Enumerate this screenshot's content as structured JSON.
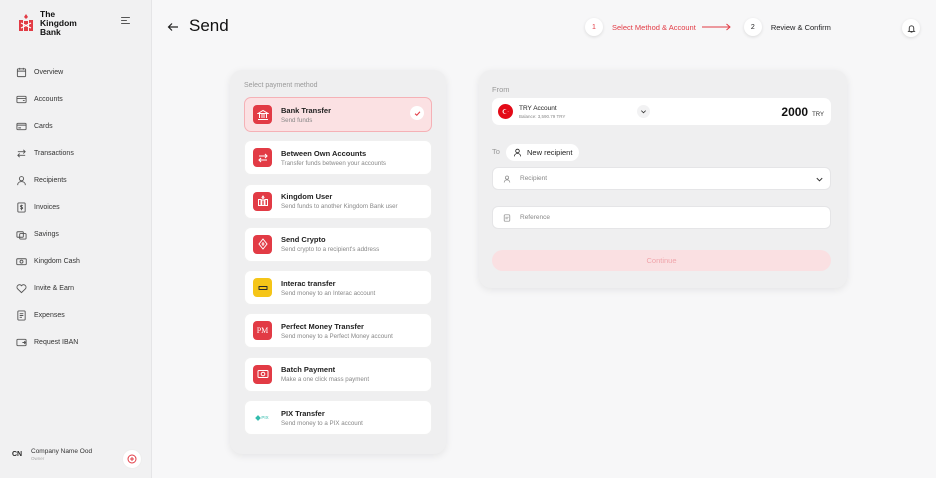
{
  "brand": {
    "name_line1": "The",
    "name_line2": "Kingdom",
    "name_line3": "Bank"
  },
  "nav": [
    {
      "label": "Overview",
      "icon": "calendar-icon"
    },
    {
      "label": "Accounts",
      "icon": "wallet-icon"
    },
    {
      "label": "Cards",
      "icon": "card-icon"
    },
    {
      "label": "Transactions",
      "icon": "transfer-arrows-icon"
    },
    {
      "label": "Recipients",
      "icon": "user-icon"
    },
    {
      "label": "Invoices",
      "icon": "invoice-icon"
    },
    {
      "label": "Savings",
      "icon": "savings-icon"
    },
    {
      "label": "Kingdom Cash",
      "icon": "cash-icon"
    },
    {
      "label": "Invite & Earn",
      "icon": "heart-icon"
    },
    {
      "label": "Expenses",
      "icon": "expenses-icon"
    },
    {
      "label": "Request IBAN",
      "icon": "iban-icon"
    }
  ],
  "account": {
    "initials": "CN",
    "name": "Company Name Ood",
    "role": "Owner"
  },
  "header": {
    "title": "Send"
  },
  "stepper": {
    "step1_num": "1",
    "step1_label": "Select Method & Account",
    "step2_num": "2",
    "step2_label": "Review & Confirm"
  },
  "method_panel": {
    "title": "Select payment method",
    "methods": [
      {
        "name": "Bank Transfer",
        "desc": "Send funds",
        "icon": "bank-icon",
        "color": "#e23b45",
        "selected": true
      },
      {
        "name": "Between Own Accounts",
        "desc": "Transfer funds between your accounts",
        "icon": "swap-icon",
        "color": "#e23b45"
      },
      {
        "name": "Kingdom User",
        "desc": "Send funds to another Kingdom Bank user",
        "icon": "kingdom-logo-icon",
        "color": "#e23b45"
      },
      {
        "name": "Send Crypto",
        "desc": "Send crypto to a recipient's address",
        "icon": "crypto-icon",
        "color": "#e23b45"
      },
      {
        "name": "Interac transfer",
        "desc": "Send money to an Interac account",
        "icon": "interac-icon",
        "color": "#f5c518"
      },
      {
        "name": "Perfect Money Transfer",
        "desc": "Send money to a Perfect Money account",
        "icon": "pm-icon",
        "color": "#e23b45",
        "badge": "PM"
      },
      {
        "name": "Batch Payment",
        "desc": "Make a one click mass payment",
        "icon": "batch-icon",
        "color": "#e23b45"
      },
      {
        "name": "PIX Transfer",
        "desc": "Send money to a PIX account",
        "icon": "pix-icon",
        "color": "#ffffff",
        "badge": "PIX"
      }
    ]
  },
  "form": {
    "from_label": "From",
    "account_name": "TRY Account",
    "account_balance": "Balance: 3,590.79 TRY",
    "amount": "2000",
    "currency": "TRY",
    "to_label": "To",
    "new_recipient": "New recipient",
    "recipient_placeholder": "Recipient",
    "reference_placeholder": "Reference",
    "continue_label": "Continue"
  },
  "colors": {
    "accent": "#e23b45",
    "selected_bg": "#fbe1e3"
  }
}
